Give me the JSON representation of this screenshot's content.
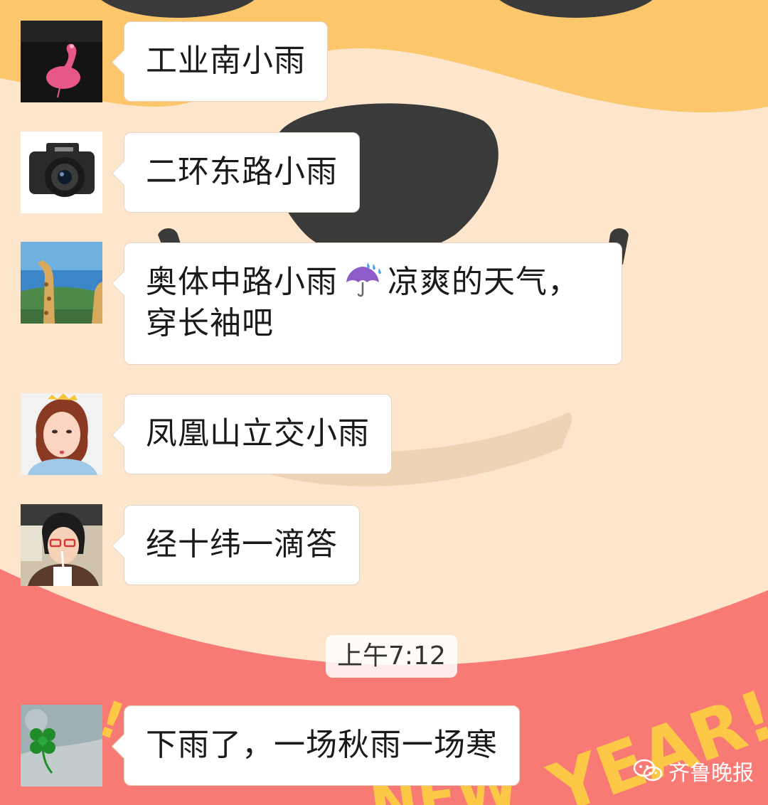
{
  "chat": {
    "messages": [
      {
        "avatar": "pink-bird-avatar",
        "text": "工业南小雨"
      },
      {
        "avatar": "camera-avatar",
        "text": "二环东路小雨"
      },
      {
        "avatar": "giraffe-avatar",
        "line1_before": "奥体中路小雨",
        "emoji": "umbrella-with-rain-icon",
        "line1_after": "凉爽的天气，",
        "line2": "穿长袖吧"
      },
      {
        "avatar": "woman-crown-avatar",
        "text": "凤凰山立交小雨"
      },
      {
        "avatar": "woman-drink-avatar",
        "text": "经十纬一滴答"
      },
      {
        "avatar": "clover-avatar",
        "text": "下雨了，一场秋雨一场寒"
      }
    ],
    "timestamp": "上午7:12"
  },
  "background": {
    "banner_text": "YEAR!",
    "banner_text_2": "NEW"
  },
  "watermark": {
    "icon": "wechat-icon",
    "label": "齐鲁晚报"
  },
  "colors": {
    "bg_cream": "#fde6cc",
    "bg_yellow": "#fcc66a",
    "bg_pink": "#f87a74",
    "bg_dark": "#3a3a3a",
    "banner_yellow": "#fcc845"
  }
}
